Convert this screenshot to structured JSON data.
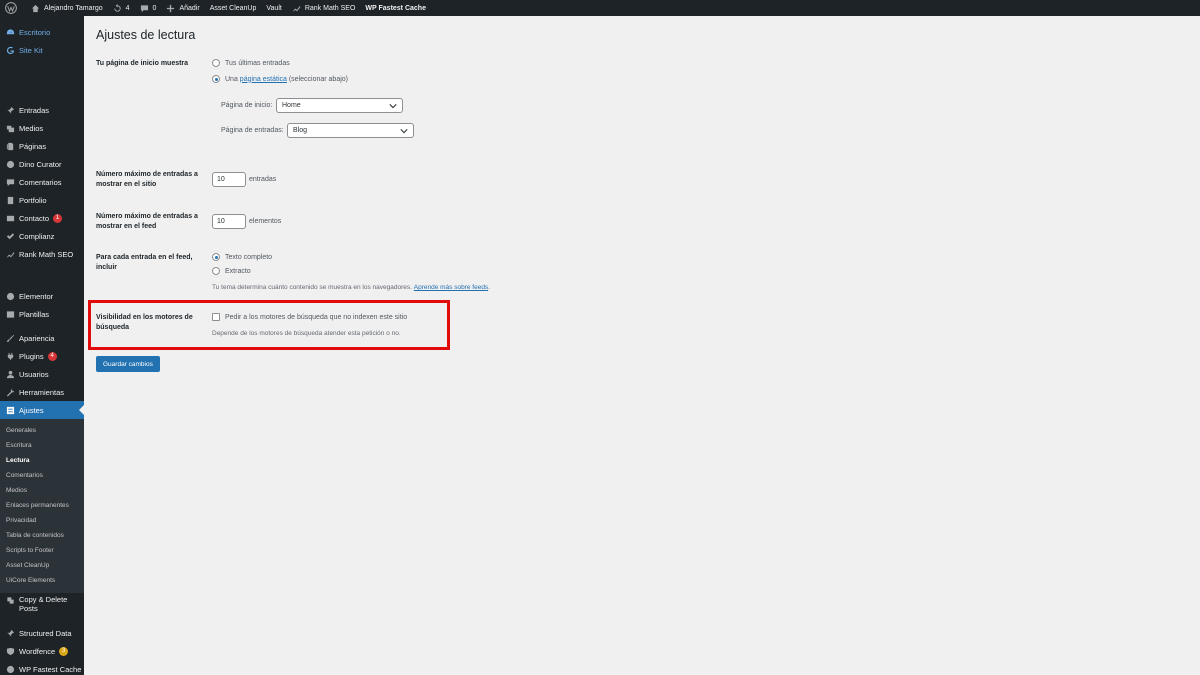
{
  "adminbar": {
    "site_name": "Alejandro Tamargo",
    "updates_count": "4",
    "comments_count": "0",
    "add_new": "Añadir",
    "items": [
      "Asset CleanUp",
      "Vault",
      "Rank Math SEO",
      "WP Fastest Cache"
    ]
  },
  "sidebar": {
    "top": [
      "Escritorio",
      "Site Kit"
    ],
    "items": [
      "Entradas",
      "Medios",
      "Páginas",
      "Dino Curator",
      "Comentarios",
      "Portfolio",
      "Contacto",
      "Complianz",
      "Rank Math SEO",
      "Elementor",
      "Plantillas",
      "Apariencia",
      "Plugins",
      "Usuarios",
      "Herramientas",
      "Ajustes"
    ],
    "contacto_badge": "1",
    "plugins_badge": "4",
    "submenu": [
      "Generales",
      "Escritura",
      "Lectura",
      "Comentarios",
      "Medios",
      "Enlaces permanentes",
      "Privacidad",
      "Tabla de contenidos",
      "Scripts to Footer",
      "Asset CleanUp",
      "UiCore Elements"
    ],
    "bottom": [
      "Copy & Delete",
      "Posts",
      "Structured Data",
      "Wordfence",
      "WP Fastest Cache"
    ],
    "wordfence_badge": "3"
  },
  "main": {
    "title": "Ajustes de lectura",
    "homepage": {
      "label": "Tu página de inicio muestra",
      "option_latest": "Tus últimas entradas",
      "option_static_prefix": "Una",
      "option_static_link": "página estática",
      "option_static_suffix": "(seleccionar abajo)",
      "front_label": "Página de inicio:",
      "front_value": "Home",
      "posts_label": "Página de entradas:",
      "posts_value": "Blog"
    },
    "posts_per_page": {
      "label_1": "Número máximo de entradas a",
      "label_2": "mostrar en el sitio",
      "value": "10",
      "unit": "entradas"
    },
    "feed": {
      "label_1": "Número máximo de entradas a",
      "label_2": "mostrar en el feed",
      "value": "10",
      "unit": "elementos"
    },
    "feed_content": {
      "label_1": "Para cada entrada en el feed,",
      "label_2": "incluir",
      "option_full": "Texto completo",
      "option_excerpt": "Extracto",
      "desc_prefix": "Tu tema determina cuánto contenido se muestra en los navegadores.",
      "desc_link": "Aprende más sobre feeds"
    },
    "visibility": {
      "label_1": "Visibilidad en los motores de",
      "label_2": "búsqueda",
      "checkbox_label": "Pedir a los motores de búsqueda que no indexen este sitio",
      "desc": "Depende de los motores de búsqueda atender esta petición o no."
    },
    "save_button": "Guardar cambios"
  },
  "colors": {
    "accent": "#2271b1",
    "highlight": "#e20b0b",
    "sidebar": "#1d2327"
  }
}
